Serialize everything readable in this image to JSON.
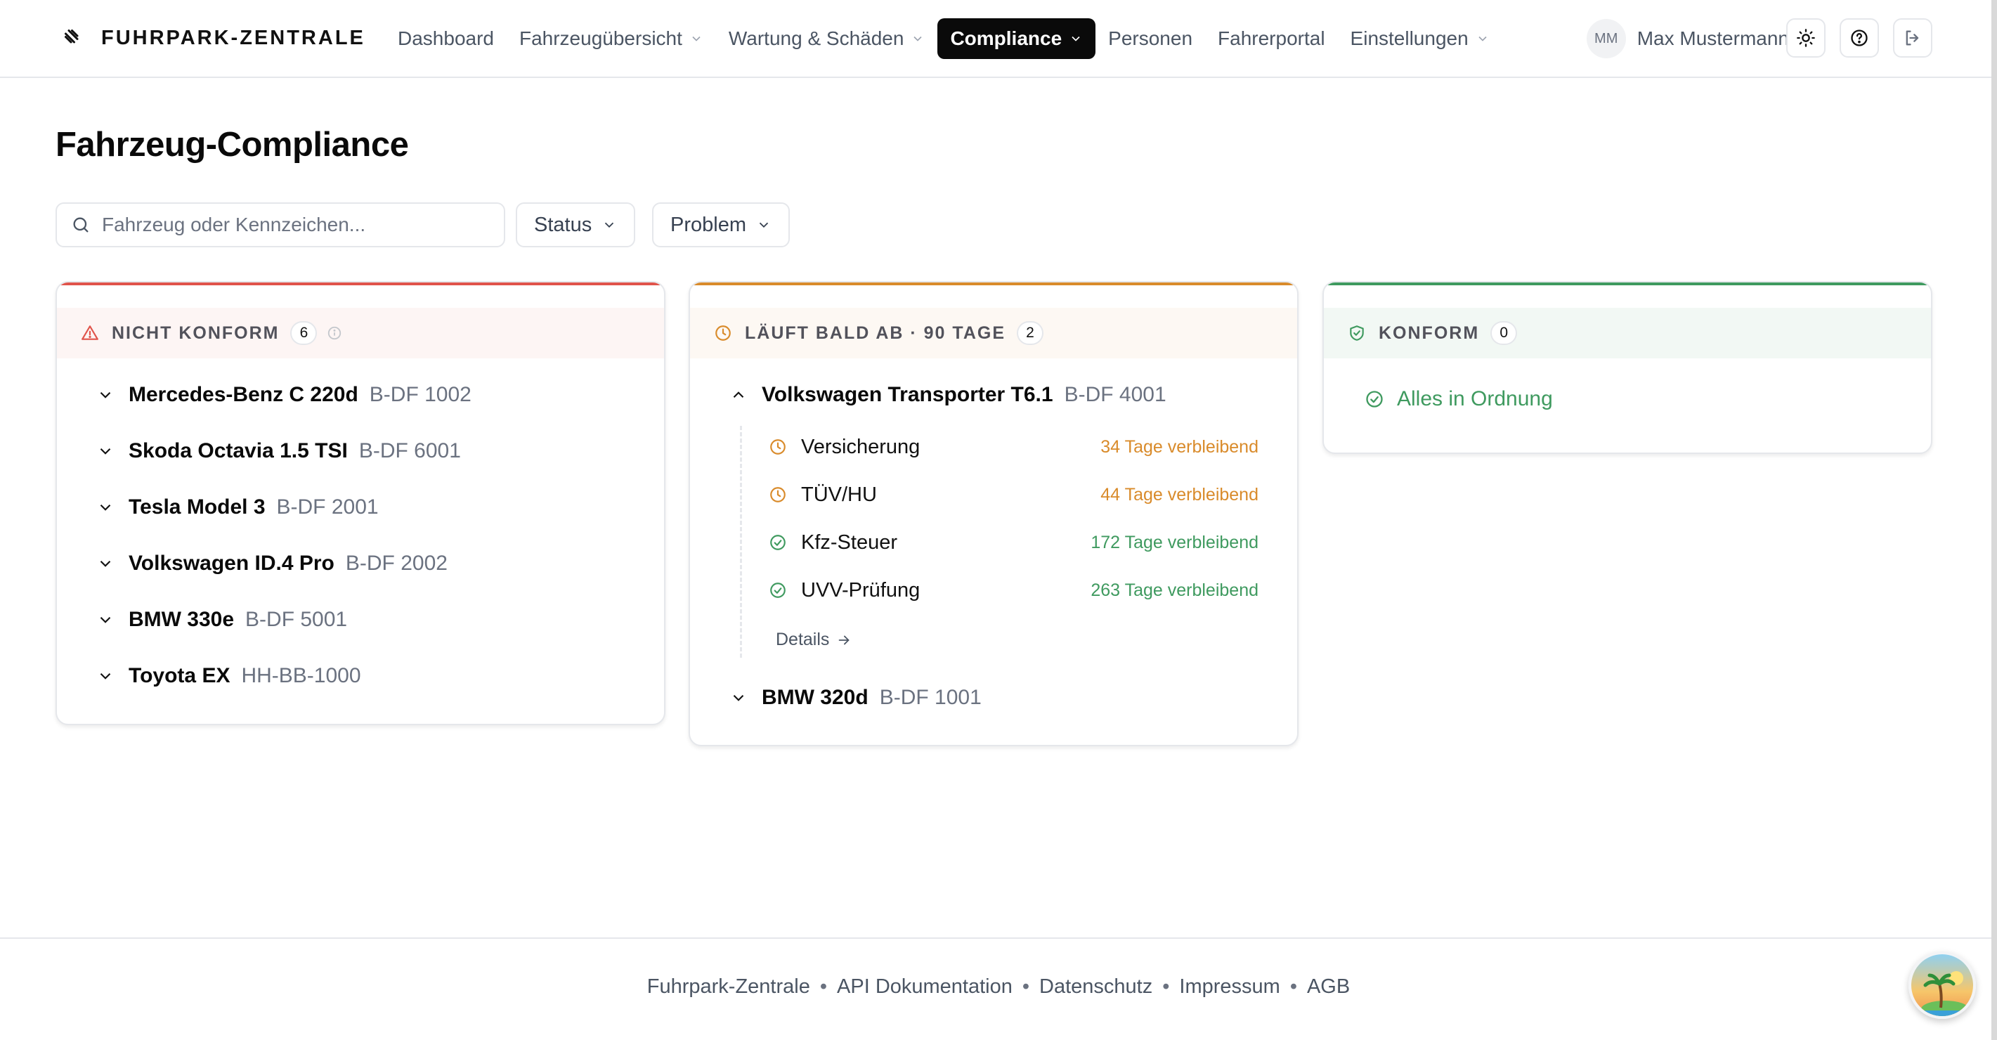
{
  "app": {
    "brand": "FUHRPARK-ZENTRALE"
  },
  "nav": [
    {
      "label": "Dashboard",
      "dropdown": false,
      "active": false
    },
    {
      "label": "Fahrzeugübersicht",
      "dropdown": true,
      "active": false
    },
    {
      "label": "Wartung & Schäden",
      "dropdown": true,
      "active": false
    },
    {
      "label": "Compliance",
      "dropdown": true,
      "active": true
    },
    {
      "label": "Personen",
      "dropdown": false,
      "active": false
    },
    {
      "label": "Fahrerportal",
      "dropdown": false,
      "active": false
    },
    {
      "label": "Einstellungen",
      "dropdown": true,
      "active": false
    }
  ],
  "user": {
    "initials": "MM",
    "name": "Max Mustermann"
  },
  "header_icons": [
    "sun-icon",
    "help-icon",
    "logout-icon"
  ],
  "page": {
    "title": "Fahrzeug-Compliance"
  },
  "filters": {
    "search_placeholder": "Fahrzeug oder Kennzeichen...",
    "search_value": "",
    "status_label": "Status",
    "problem_label": "Problem"
  },
  "colors": {
    "non_compliant": "#e0544b",
    "expiring": "#d98b2b",
    "compliant": "#3f9a5f",
    "active_nav": "#0a0a0a"
  },
  "columns": {
    "non_compliant": {
      "title": "NICHT KONFORM",
      "count": "6",
      "vehicles": [
        {
          "name": "Mercedes-Benz C 220d",
          "plate": "B-DF 1002"
        },
        {
          "name": "Skoda Octavia 1.5 TSI",
          "plate": "B-DF 6001"
        },
        {
          "name": "Tesla Model 3",
          "plate": "B-DF 2001"
        },
        {
          "name": "Volkswagen ID.4 Pro",
          "plate": "B-DF 2002"
        },
        {
          "name": "BMW 330e",
          "plate": "B-DF 5001"
        },
        {
          "name": "Toyota EX",
          "plate": "HH-BB-1000"
        }
      ]
    },
    "expiring": {
      "title": "LÄUFT BALD AB · 90 TAGE",
      "count": "2",
      "vehicles": [
        {
          "name": "Volkswagen Transporter T6.1",
          "plate": "B-DF 4001",
          "expanded": true,
          "checks": [
            {
              "label": "Versicherung",
              "remaining": "34 Tage verbleibend",
              "status": "warning"
            },
            {
              "label": "TÜV/HU",
              "remaining": "44 Tage verbleibend",
              "status": "warning"
            },
            {
              "label": "Kfz-Steuer",
              "remaining": "172 Tage verbleibend",
              "status": "ok"
            },
            {
              "label": "UVV-Prüfung",
              "remaining": "263 Tage verbleibend",
              "status": "ok"
            }
          ],
          "details_label": "Details"
        },
        {
          "name": "BMW 320d",
          "plate": "B-DF 1001",
          "expanded": false
        }
      ]
    },
    "compliant": {
      "title": "KONFORM",
      "count": "0",
      "empty_message": "Alles in Ordnung"
    }
  },
  "footer": {
    "links": [
      "Fuhrpark-Zentrale",
      "API Dokumentation",
      "Datenschutz",
      "Impressum",
      "AGB"
    ],
    "separator": "•"
  }
}
